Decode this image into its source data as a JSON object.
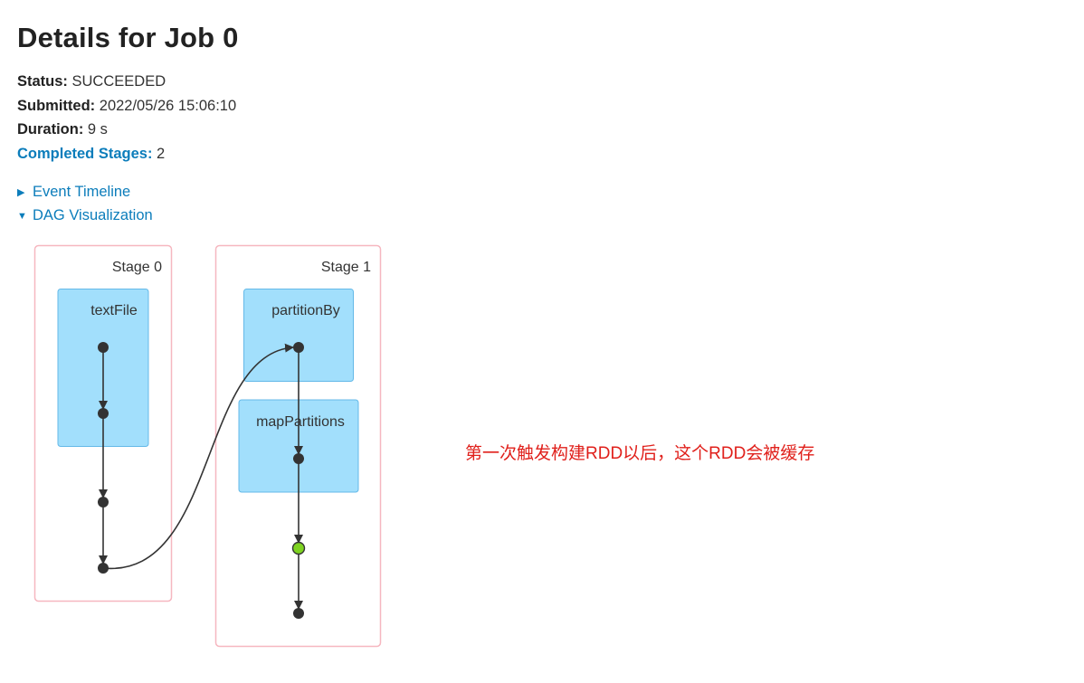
{
  "page": {
    "title": "Details for Job 0"
  },
  "summary": {
    "status_label": "Status:",
    "status_value": "SUCCEEDED",
    "submitted_label": "Submitted:",
    "submitted_value": "2022/05/26 15:06:10",
    "duration_label": "Duration:",
    "duration_value": "9 s",
    "completed_stages_label": "Completed Stages:",
    "completed_stages_value": "2"
  },
  "toggles": {
    "event_timeline": "Event Timeline",
    "dag_visualization": "DAG Visualization"
  },
  "dag": {
    "stages": [
      {
        "label": "Stage 0",
        "operations": [
          "textFile"
        ]
      },
      {
        "label": "Stage 1",
        "operations": [
          "partitionBy",
          "mapPartitions"
        ]
      }
    ],
    "cached_node_color": "#7ed321"
  },
  "annotation": "第一次触发构建RDD以后，这个RDD会被缓存",
  "colors": {
    "link": "#0c7dbb",
    "stage_border": "#f6b7c0",
    "op_fill": "#a2dffc",
    "op_border": "#64b9e8",
    "annotation": "#e0201b"
  }
}
